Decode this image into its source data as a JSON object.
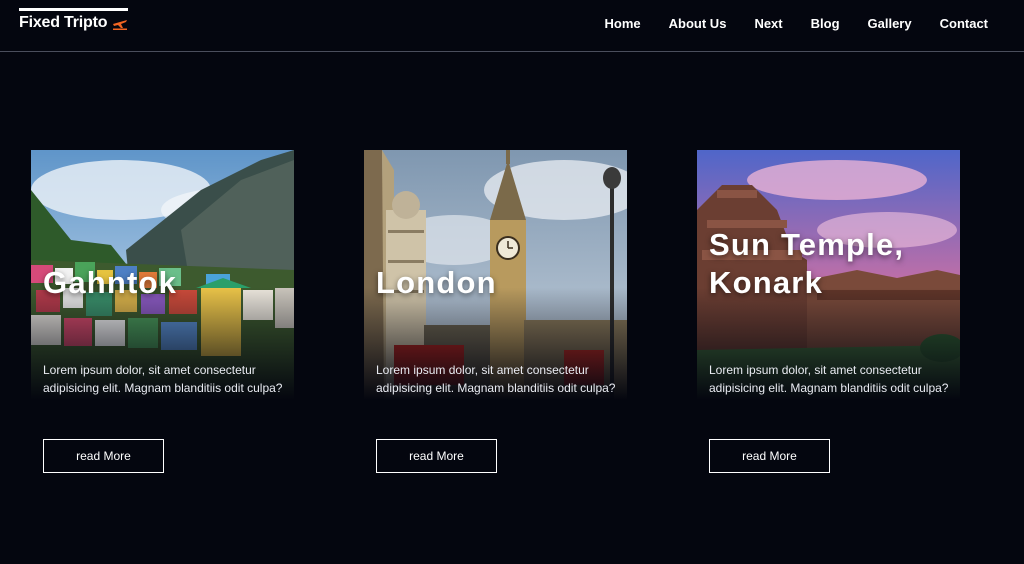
{
  "brand": {
    "name": "Fixed Tripto",
    "icon": "plane-icon",
    "accent": "#f26522"
  },
  "nav": {
    "items": [
      {
        "label": "Home"
      },
      {
        "label": "About Us"
      },
      {
        "label": "Next"
      },
      {
        "label": "Blog"
      },
      {
        "label": "Gallery"
      },
      {
        "label": "Contact"
      }
    ]
  },
  "cards": [
    {
      "title": "Gahntok",
      "text": "Lorem ipsum dolor, sit amet consectetur adipisicing elit. Magnam blanditiis odit culpa?",
      "button": "read More"
    },
    {
      "title": "London",
      "text": "Lorem ipsum dolor, sit amet consectetur adipisicing elit. Magnam blanditiis odit culpa?",
      "button": "read More"
    },
    {
      "title": "Sun Temple, Konark",
      "text": "Lorem ipsum dolor, sit amet consectetur adipisicing elit. Magnam blanditiis odit culpa?",
      "button": "read More"
    }
  ]
}
